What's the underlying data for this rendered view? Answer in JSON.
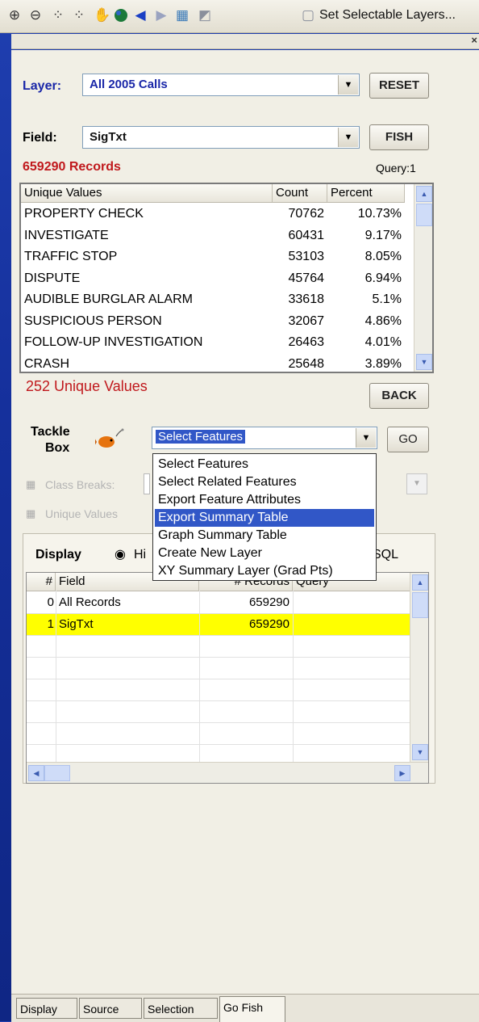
{
  "toolbar": {
    "icons": [
      "zoom-in-icon",
      "zoom-out-icon",
      "fixed-zoom-in-icon",
      "fixed-zoom-out-icon",
      "pan-icon",
      "globe-icon",
      "back-arrow-icon",
      "forward-arrow-icon",
      "select-features-icon",
      "clear-selection-icon",
      "layer-selection-icon"
    ],
    "set_selectable_layers": "Set Selectable Layers..."
  },
  "close_glyph": "×",
  "layer": {
    "label": "Layer:",
    "value": "All 2005 Calls"
  },
  "reset_label": "RESET",
  "field": {
    "label": "Field:",
    "value": "SigTxt"
  },
  "fish_label": "FISH",
  "records_count": "659290 Records",
  "query_label": "Query:1",
  "unique_table": {
    "columns": [
      "Unique Values",
      "Count",
      "Percent"
    ],
    "rows": [
      [
        "PROPERTY CHECK",
        "70762",
        "10.73%"
      ],
      [
        "INVESTIGATE",
        "60431",
        "9.17%"
      ],
      [
        "TRAFFIC STOP",
        "53103",
        "8.05%"
      ],
      [
        "DISPUTE",
        "45764",
        "6.94%"
      ],
      [
        "AUDIBLE BURGLAR ALARM",
        "33618",
        "5.1%"
      ],
      [
        "SUSPICIOUS PERSON",
        "32067",
        "4.86%"
      ],
      [
        "FOLLOW-UP INVESTIGATION",
        "26463",
        "4.01%"
      ],
      [
        "CRASH",
        "25648",
        "3.89%"
      ]
    ]
  },
  "unique_count": "252 Unique Values",
  "back_label": "BACK",
  "tackle_box": {
    "line1": "Tackle",
    "line2": "Box"
  },
  "action_select": {
    "value": "Select Features"
  },
  "go_label": "GO",
  "class_breaks_label": "Class Breaks:",
  "unique_values_label": "Unique Values",
  "dropdown": {
    "options": [
      "Select Features",
      "Select Related Features",
      "Export Feature Attributes",
      "Export Summary Table",
      "Graph Summary Table",
      "Create New Layer",
      "XY Summary Layer (Grad Pts)"
    ],
    "selected_index": 3
  },
  "display": {
    "label": "Display",
    "radio_text": "Hi",
    "sql_text": "SQL"
  },
  "query_table": {
    "columns": [
      "#",
      "Field",
      "# Records",
      "Query"
    ],
    "rows": [
      [
        "0",
        "All Records",
        "659290",
        ""
      ],
      [
        "1",
        "SigTxt",
        "659290",
        ""
      ]
    ],
    "highlight_color": "#ffff00"
  },
  "tabs": [
    "Display",
    "Source",
    "Selection",
    "Go Fish"
  ],
  "active_tab": "Go Fish",
  "colors": {
    "accent_red": "#c0181c",
    "label_blue": "#1a27a8",
    "selection_blue": "#3157c7",
    "highlight_yellow": "#ffff00"
  }
}
